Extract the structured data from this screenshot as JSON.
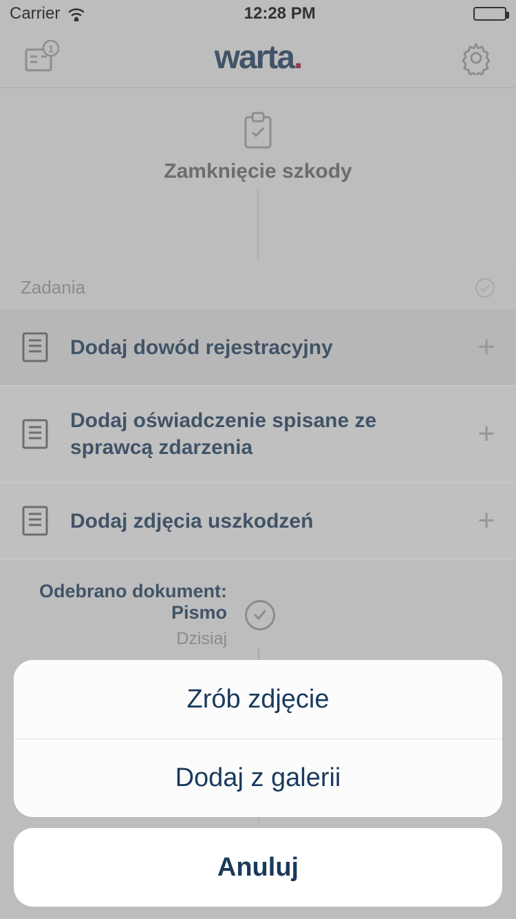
{
  "status": {
    "carrier": "Carrier",
    "time": "12:28 PM"
  },
  "brand": {
    "name": "warta",
    "dot": "."
  },
  "notification_badge": "1",
  "timeline": {
    "title": "Zamknięcie szkody"
  },
  "section": {
    "title": "Zadania"
  },
  "tasks": [
    {
      "label": "Dodaj dowód rejestracyjny"
    },
    {
      "label": "Dodaj oświadczenie spisane ze sprawcą zdarzenia"
    },
    {
      "label": "Dodaj zdjęcia uszkodzeń"
    }
  ],
  "event": {
    "title": "Odebrano dokument: Pismo",
    "date": "Dzisiaj"
  },
  "sheet": {
    "option1": "Zrób zdjęcie",
    "option2": "Dodaj z galerii",
    "cancel": "Anuluj"
  }
}
